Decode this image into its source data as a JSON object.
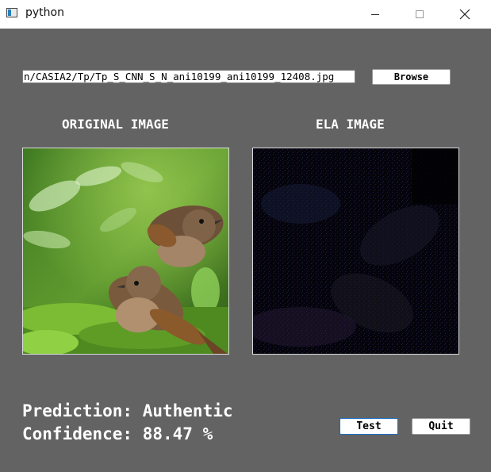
{
  "window": {
    "title": "python",
    "controls": [
      "minimize-icon",
      "maximize-icon",
      "close-icon"
    ]
  },
  "file_path": {
    "value": "n/CASIA2/Tp/Tp_S_CNN_S_N_ani10199_ani10199_12408.jpg"
  },
  "buttons": {
    "browse": "Browse",
    "test": "Test",
    "quit": "Quit"
  },
  "panels": {
    "original_heading": "ORIGINAL IMAGE",
    "ela_heading": "ELA IMAGE"
  },
  "results": {
    "prediction": "Prediction: Authentic",
    "confidence": "Confidence: 88.47 %"
  },
  "colors": {
    "window_bg": "#636363",
    "accent": "#1c6fc7"
  }
}
